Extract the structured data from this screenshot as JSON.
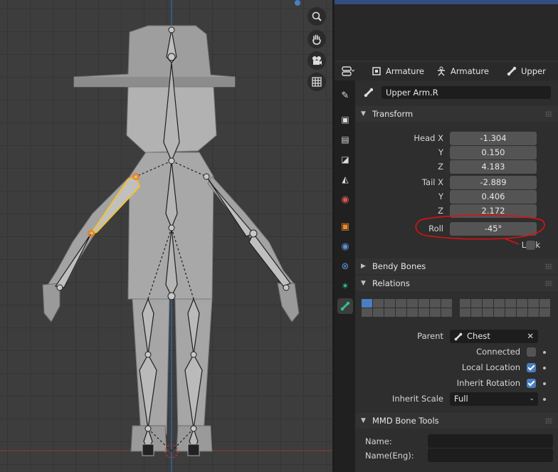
{
  "props": {
    "breadcrumb": {
      "item1": "Armature",
      "item2": "Armature",
      "item3": "Upper"
    },
    "bone_name": "Upper Arm.R",
    "transform": {
      "title": "Transform",
      "head_label": "Head X",
      "y_label": "Y",
      "z_label": "Z",
      "head_x": "-1.304",
      "head_y": "0.150",
      "head_z": "4.183",
      "tail_label": "Tail X",
      "tail_x": "-2.889",
      "tail_y": "0.406",
      "tail_z": "2.172",
      "roll_label": "Roll",
      "roll_value": "-45°",
      "lock_label": "Lock"
    },
    "bendy_bones": "Bendy Bones",
    "relations": {
      "title": "Relations",
      "parent_label": "Parent",
      "parent_value": "Chest",
      "connected_label": "Connected",
      "local_location_label": "Local Location",
      "inherit_rotation_label": "Inherit Rotation",
      "inherit_scale_label": "Inherit Scale",
      "inherit_scale_value": "Full"
    },
    "mmd": {
      "title": "MMD Bone Tools",
      "name_label": "Name:",
      "name_eng_label": "Name(Eng):"
    }
  },
  "colors": {
    "accent": "#4a7ec2",
    "selected_bone": "#f2c12e",
    "annotation": "#e01010",
    "active_bone_joint": "#f07a1a"
  }
}
